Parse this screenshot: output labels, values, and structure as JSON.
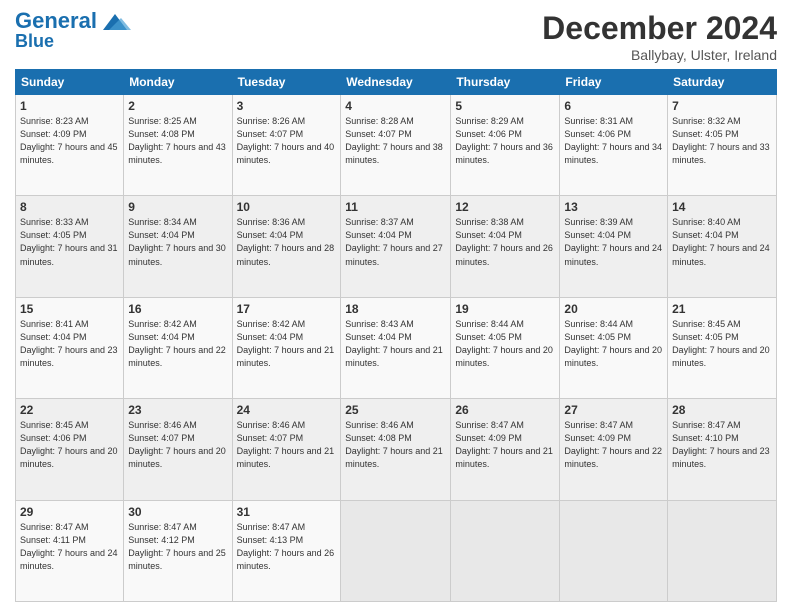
{
  "header": {
    "logo_line1": "General",
    "logo_line2": "Blue",
    "month_title": "December 2024",
    "location": "Ballybay, Ulster, Ireland"
  },
  "weekdays": [
    "Sunday",
    "Monday",
    "Tuesday",
    "Wednesday",
    "Thursday",
    "Friday",
    "Saturday"
  ],
  "weeks": [
    [
      {
        "day": "1",
        "sunrise": "Sunrise: 8:23 AM",
        "sunset": "Sunset: 4:09 PM",
        "daylight": "Daylight: 7 hours and 45 minutes."
      },
      {
        "day": "2",
        "sunrise": "Sunrise: 8:25 AM",
        "sunset": "Sunset: 4:08 PM",
        "daylight": "Daylight: 7 hours and 43 minutes."
      },
      {
        "day": "3",
        "sunrise": "Sunrise: 8:26 AM",
        "sunset": "Sunset: 4:07 PM",
        "daylight": "Daylight: 7 hours and 40 minutes."
      },
      {
        "day": "4",
        "sunrise": "Sunrise: 8:28 AM",
        "sunset": "Sunset: 4:07 PM",
        "daylight": "Daylight: 7 hours and 38 minutes."
      },
      {
        "day": "5",
        "sunrise": "Sunrise: 8:29 AM",
        "sunset": "Sunset: 4:06 PM",
        "daylight": "Daylight: 7 hours and 36 minutes."
      },
      {
        "day": "6",
        "sunrise": "Sunrise: 8:31 AM",
        "sunset": "Sunset: 4:06 PM",
        "daylight": "Daylight: 7 hours and 34 minutes."
      },
      {
        "day": "7",
        "sunrise": "Sunrise: 8:32 AM",
        "sunset": "Sunset: 4:05 PM",
        "daylight": "Daylight: 7 hours and 33 minutes."
      }
    ],
    [
      {
        "day": "8",
        "sunrise": "Sunrise: 8:33 AM",
        "sunset": "Sunset: 4:05 PM",
        "daylight": "Daylight: 7 hours and 31 minutes."
      },
      {
        "day": "9",
        "sunrise": "Sunrise: 8:34 AM",
        "sunset": "Sunset: 4:04 PM",
        "daylight": "Daylight: 7 hours and 30 minutes."
      },
      {
        "day": "10",
        "sunrise": "Sunrise: 8:36 AM",
        "sunset": "Sunset: 4:04 PM",
        "daylight": "Daylight: 7 hours and 28 minutes."
      },
      {
        "day": "11",
        "sunrise": "Sunrise: 8:37 AM",
        "sunset": "Sunset: 4:04 PM",
        "daylight": "Daylight: 7 hours and 27 minutes."
      },
      {
        "day": "12",
        "sunrise": "Sunrise: 8:38 AM",
        "sunset": "Sunset: 4:04 PM",
        "daylight": "Daylight: 7 hours and 26 minutes."
      },
      {
        "day": "13",
        "sunrise": "Sunrise: 8:39 AM",
        "sunset": "Sunset: 4:04 PM",
        "daylight": "Daylight: 7 hours and 24 minutes."
      },
      {
        "day": "14",
        "sunrise": "Sunrise: 8:40 AM",
        "sunset": "Sunset: 4:04 PM",
        "daylight": "Daylight: 7 hours and 24 minutes."
      }
    ],
    [
      {
        "day": "15",
        "sunrise": "Sunrise: 8:41 AM",
        "sunset": "Sunset: 4:04 PM",
        "daylight": "Daylight: 7 hours and 23 minutes."
      },
      {
        "day": "16",
        "sunrise": "Sunrise: 8:42 AM",
        "sunset": "Sunset: 4:04 PM",
        "daylight": "Daylight: 7 hours and 22 minutes."
      },
      {
        "day": "17",
        "sunrise": "Sunrise: 8:42 AM",
        "sunset": "Sunset: 4:04 PM",
        "daylight": "Daylight: 7 hours and 21 minutes."
      },
      {
        "day": "18",
        "sunrise": "Sunrise: 8:43 AM",
        "sunset": "Sunset: 4:04 PM",
        "daylight": "Daylight: 7 hours and 21 minutes."
      },
      {
        "day": "19",
        "sunrise": "Sunrise: 8:44 AM",
        "sunset": "Sunset: 4:05 PM",
        "daylight": "Daylight: 7 hours and 20 minutes."
      },
      {
        "day": "20",
        "sunrise": "Sunrise: 8:44 AM",
        "sunset": "Sunset: 4:05 PM",
        "daylight": "Daylight: 7 hours and 20 minutes."
      },
      {
        "day": "21",
        "sunrise": "Sunrise: 8:45 AM",
        "sunset": "Sunset: 4:05 PM",
        "daylight": "Daylight: 7 hours and 20 minutes."
      }
    ],
    [
      {
        "day": "22",
        "sunrise": "Sunrise: 8:45 AM",
        "sunset": "Sunset: 4:06 PM",
        "daylight": "Daylight: 7 hours and 20 minutes."
      },
      {
        "day": "23",
        "sunrise": "Sunrise: 8:46 AM",
        "sunset": "Sunset: 4:07 PM",
        "daylight": "Daylight: 7 hours and 20 minutes."
      },
      {
        "day": "24",
        "sunrise": "Sunrise: 8:46 AM",
        "sunset": "Sunset: 4:07 PM",
        "daylight": "Daylight: 7 hours and 21 minutes."
      },
      {
        "day": "25",
        "sunrise": "Sunrise: 8:46 AM",
        "sunset": "Sunset: 4:08 PM",
        "daylight": "Daylight: 7 hours and 21 minutes."
      },
      {
        "day": "26",
        "sunrise": "Sunrise: 8:47 AM",
        "sunset": "Sunset: 4:09 PM",
        "daylight": "Daylight: 7 hours and 21 minutes."
      },
      {
        "day": "27",
        "sunrise": "Sunrise: 8:47 AM",
        "sunset": "Sunset: 4:09 PM",
        "daylight": "Daylight: 7 hours and 22 minutes."
      },
      {
        "day": "28",
        "sunrise": "Sunrise: 8:47 AM",
        "sunset": "Sunset: 4:10 PM",
        "daylight": "Daylight: 7 hours and 23 minutes."
      }
    ],
    [
      {
        "day": "29",
        "sunrise": "Sunrise: 8:47 AM",
        "sunset": "Sunset: 4:11 PM",
        "daylight": "Daylight: 7 hours and 24 minutes."
      },
      {
        "day": "30",
        "sunrise": "Sunrise: 8:47 AM",
        "sunset": "Sunset: 4:12 PM",
        "daylight": "Daylight: 7 hours and 25 minutes."
      },
      {
        "day": "31",
        "sunrise": "Sunrise: 8:47 AM",
        "sunset": "Sunset: 4:13 PM",
        "daylight": "Daylight: 7 hours and 26 minutes."
      },
      null,
      null,
      null,
      null
    ]
  ]
}
